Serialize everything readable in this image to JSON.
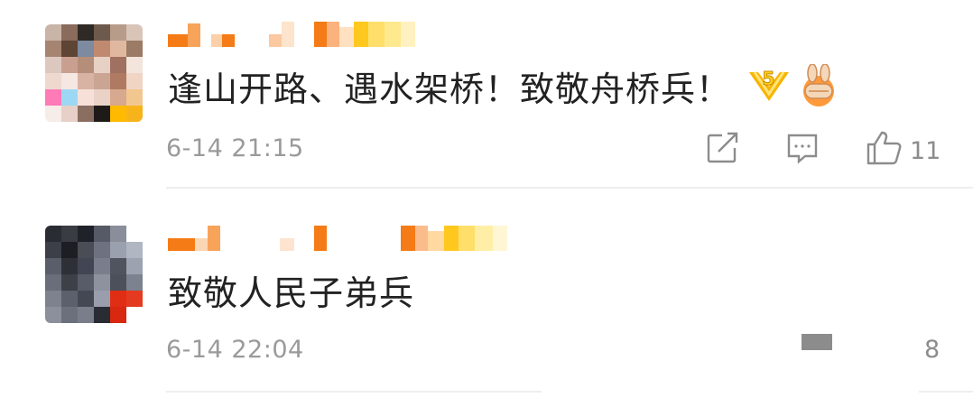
{
  "comments": [
    {
      "content": "逢山开路、遇水架桥！致敬舟桥兵！",
      "emoji_1": "medal-5-emoji",
      "emoji_2": "victory-hand-emoji",
      "time": "6-14 21:15",
      "likes": "11"
    },
    {
      "content": "致敬人民子弟兵",
      "time": "6-14 22:04",
      "likes": "8"
    }
  ],
  "icons": [
    "share-icon",
    "comment-icon",
    "like-icon"
  ],
  "colors": {
    "text": "#222222",
    "meta": "#9a9a9a",
    "icon": "#8c8c8c",
    "divider": "#eeeeee",
    "username_orange": "#f47b16",
    "username_yellow": "#ffc81e"
  }
}
